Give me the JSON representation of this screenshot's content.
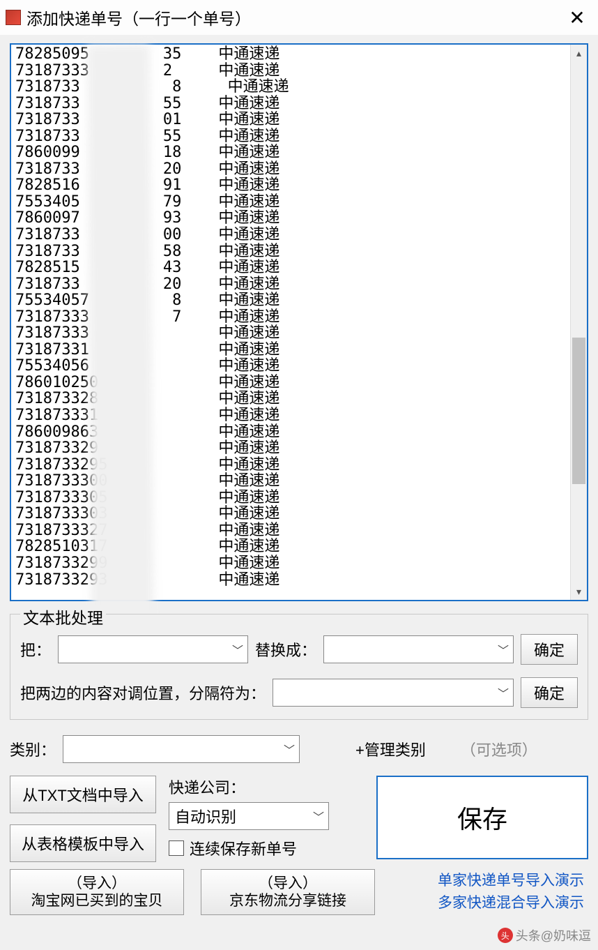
{
  "window": {
    "title": "添加快递单号（一行一个单号）",
    "close_icon": "✕"
  },
  "tracking_lines": [
    "78285095        35    中通速递",
    "73187333        2     中通速递",
    "7318733          8     中通速递",
    "7318733         55    中通速递",
    "7318733         01    中通速递",
    "7318733         55    中通速递",
    "7860099         18    中通速递",
    "7318733         20    中通速递",
    "7828516         91    中通速递",
    "7553405         79    中通速递",
    "7860097         93    中通速递",
    "7318733         00    中通速递",
    "7318733         58    中通速递",
    "7828515         43    中通速递",
    "7318733         20    中通速递",
    "75534057         8    中通速递",
    "73187333         7    中通速递",
    "73187333              中通速递",
    "73187331              中通速递",
    "75534056              中通速递",
    "786010250             中通速递",
    "731873328             中通速递",
    "731873331             中通速递",
    "786009863             中通速递",
    "731873329             中通速递",
    "7318733295            中通速递",
    "7318733300            中通速递",
    "7318733305            中通速递",
    "7318733303            中通速递",
    "7318733327            中通速递",
    "7828510317            中通速递",
    "7318733299            中通速递",
    "7318733293            中通速递"
  ],
  "batch": {
    "group_label": "文本批处理",
    "replace_from_label": "把：",
    "replace_to_label": "替换成：",
    "ok_label": "确定",
    "swap_label": "把两边的内容对调位置，分隔符为：",
    "ok_label2": "确定"
  },
  "category": {
    "label": "类别：",
    "manage_link": "+管理类别",
    "optional": "（可选项）"
  },
  "import": {
    "txt_btn": "从TXT文档中导入",
    "template_btn": "从表格模板中导入",
    "courier_label": "快递公司：",
    "courier_value": "自动识别",
    "continuous_label": "连续保存新单号",
    "save_label": "保存",
    "taobao_line1": "（导入）",
    "taobao_line2": "淘宝网已买到的宝贝",
    "jd_line1": "（导入）",
    "jd_line2": "京东物流分享链接",
    "demo1": "单家快递单号导入演示",
    "demo2": "多家快递混合导入演示"
  },
  "watermark": "头条@奶味逗"
}
